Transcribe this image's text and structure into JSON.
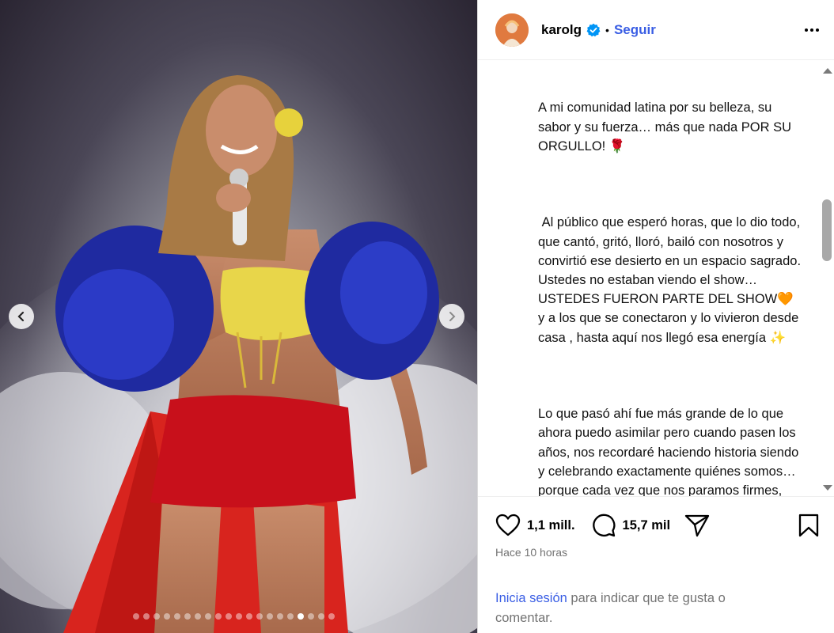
{
  "media": {
    "carousel_total": 20,
    "carousel_active_index": 16
  },
  "header": {
    "username": "karolg",
    "separator": "•",
    "follow_label": "Seguir"
  },
  "caption": {
    "paragraphs": [
      "A mi comunidad latina por su belleza, su sabor y su fuerza… más que nada POR SU ORGULLO! 🌹",
      " Al público que esperó horas, que lo dio todo, que cantó, gritó, lloró, bailó con nosotros y convirtió ese desierto en un espacio sagrado. Ustedes no estaban viendo el show… USTEDES FUERON PARTE DEL SHOW🧡  y a los que se conectaron y lo vivieron desde casa , hasta aquí nos llegó esa energía ✨",
      "Lo que pasó ahí fue más grande de lo que ahora puedo asimilar pero cuando pasen los años, nos recordaré haciendo historia siendo y celebrando exactamente quiénes somos… porque cada vez que nos paramos firmes, unidos, el mundo lo siente✨ FINALMENTE NUESTRAS RAÍCES SE TOMAN EL MAIN STAGE 🥹 💗"
    ]
  },
  "actions": {
    "likes": "1,1 mill.",
    "comments": "15,7 mil"
  },
  "timestamp": "Hace 10 horas",
  "login": {
    "link": "Inicia sesión",
    "text": " para indicar que te gusta o comentar."
  },
  "colors": {
    "link_blue": "#3a5ee4",
    "muted": "#737373",
    "verified": "#0095f6"
  },
  "icons": [
    "chevron-left-icon",
    "chevron-right-icon",
    "verified-icon",
    "more-icon",
    "heart-icon",
    "comment-icon",
    "share-icon",
    "bookmark-icon"
  ]
}
